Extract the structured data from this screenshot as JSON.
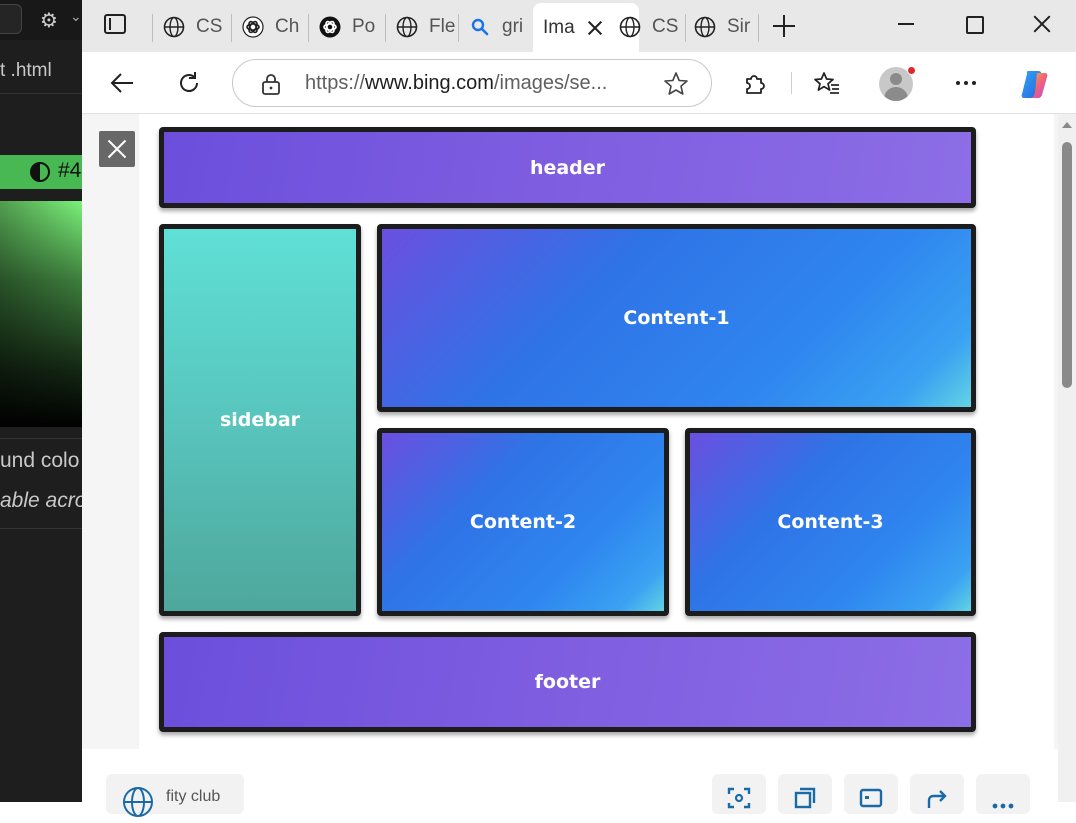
{
  "background_app": {
    "file_tab": "t .html",
    "color_hex_fragment": "#4",
    "text_line_1": "und colo",
    "text_line_2": "able acros"
  },
  "browser": {
    "tabs": [
      {
        "label": "CS",
        "icon": "globe-icon"
      },
      {
        "label": "Ch",
        "icon": "chatgpt-icon"
      },
      {
        "label": "Po",
        "icon": "chatgpt-icon"
      },
      {
        "label": "Fle",
        "icon": "globe-icon"
      },
      {
        "label": "gri",
        "icon": "search-icon"
      },
      {
        "label": "Ima",
        "icon": "none",
        "active": true
      },
      {
        "label": "CS",
        "icon": "globe-icon"
      },
      {
        "label": "Sir",
        "icon": "globe-icon"
      }
    ],
    "address_bar": {
      "url_prefix": "https://",
      "url_domain": "www.bing.com",
      "url_rest": "/images/se..."
    }
  },
  "image_layout": {
    "header": "header",
    "sidebar": "sidebar",
    "content_1": "Content-1",
    "content_2": "Content-2",
    "content_3": "Content-3",
    "footer": "footer"
  },
  "bottom_bar": {
    "source_label": "fity club"
  },
  "colors": {
    "header_footer": "#7a5ade",
    "sidebar": "#58c5bd",
    "content": "#2f80ec",
    "border": "#1c1c1c"
  }
}
